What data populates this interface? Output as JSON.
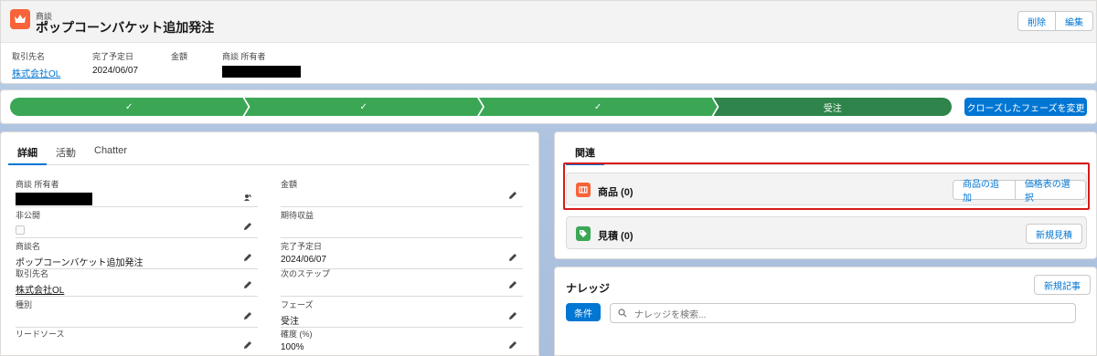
{
  "header": {
    "object_type": "商談",
    "title": "ポップコーンバケット追加発注",
    "delete_label": "削除",
    "edit_label": "編集",
    "fields": [
      {
        "label": "取引先名",
        "value": "株式会社OL"
      },
      {
        "label": "完了予定日",
        "value": "2024/06/07"
      },
      {
        "label": "金額",
        "value": ""
      },
      {
        "label": "商談 所有者",
        "value": ""
      }
    ]
  },
  "path": {
    "stages": [
      "✓",
      "✓",
      "✓",
      "受注"
    ],
    "button_label": "クローズしたフェーズを変更"
  },
  "detail": {
    "tabs": [
      "詳細",
      "活動",
      "Chatter"
    ],
    "left_fields": [
      {
        "label": "商談 所有者",
        "value": ""
      },
      {
        "label": "非公開",
        "value": ""
      },
      {
        "label": "商談名",
        "value": "ポップコーンバケット追加発注"
      },
      {
        "label": "取引先名",
        "value": "株式会社OL"
      },
      {
        "label": "種別",
        "value": ""
      },
      {
        "label": "リードソース",
        "value": ""
      }
    ],
    "right_fields": [
      {
        "label": "金額",
        "value": ""
      },
      {
        "label": "期待収益",
        "value": ""
      },
      {
        "label": "完了予定日",
        "value": "2024/06/07"
      },
      {
        "label": "次のステップ",
        "value": ""
      },
      {
        "label": "フェーズ",
        "value": "受注"
      },
      {
        "label": "確度 (%)",
        "value": "100%"
      }
    ]
  },
  "related": {
    "tab": "関連",
    "products": {
      "title": "商品 (0)",
      "add_label": "商品の追加",
      "pricebook_label": "価格表の選択"
    },
    "quotes": {
      "title": "見積 (0)",
      "new_label": "新規見積"
    }
  },
  "knowledge": {
    "title": "ナレッジ",
    "new_label": "新規記事",
    "condition_label": "条件",
    "search_placeholder": "ナレッジを検索..."
  },
  "colors": {
    "brand": "#0176d3",
    "path_complete": "#3ba755",
    "path_current": "#2e844a",
    "opportunity_icon": "#f8633a",
    "highlight": "#d71a1a"
  }
}
